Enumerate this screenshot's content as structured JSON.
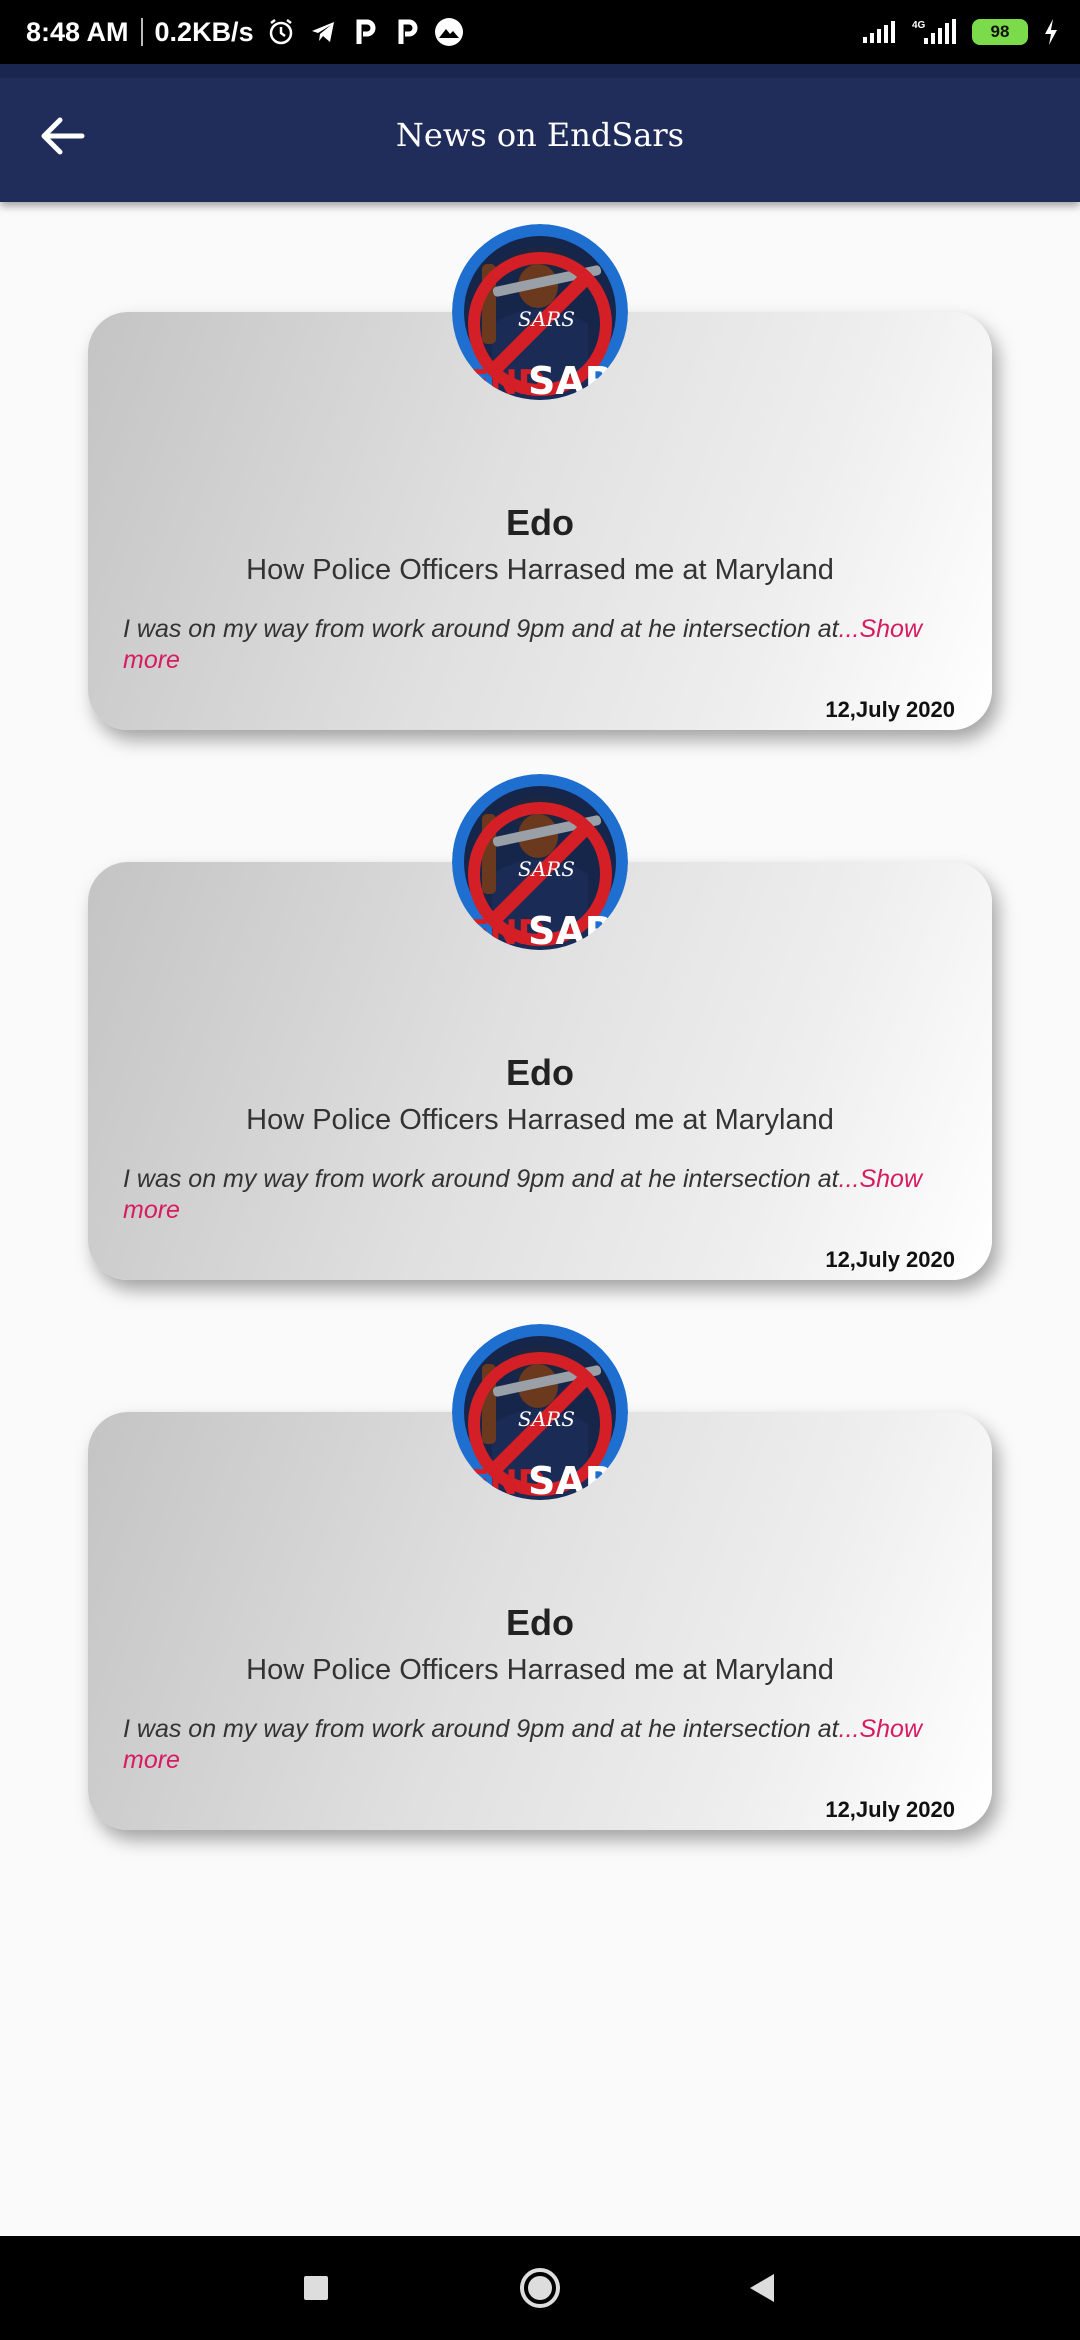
{
  "status_bar": {
    "time": "8:48 AM",
    "speed": "0.2KB/s",
    "network": "4G",
    "battery": "98"
  },
  "app_bar": {
    "title": "News on EndSars",
    "back_icon": "arrow-left-icon"
  },
  "posts": [
    {
      "author": "Edo",
      "headline": "How Police Officers Harrased me at Maryland",
      "excerpt": "I was on my way from work around 9pm and at he intersection at",
      "show_more": "...Show more",
      "date": "12,July 2020"
    },
    {
      "author": "Edo",
      "headline": "How Police Officers Harrased me at Maryland",
      "excerpt": "I was on my way from work around 9pm and at he intersection at",
      "show_more": "...Show more",
      "date": "12,July 2020"
    },
    {
      "author": "Edo",
      "headline": "How Police Officers Harrased me at Maryland",
      "excerpt": "I was on my way from work around 9pm and at he intersection at",
      "show_more": "...Show more",
      "date": "12,July 2020"
    }
  ],
  "colors": {
    "app_bar": "#202c5a",
    "accent": "#d81b60",
    "background": "#fafafa"
  }
}
